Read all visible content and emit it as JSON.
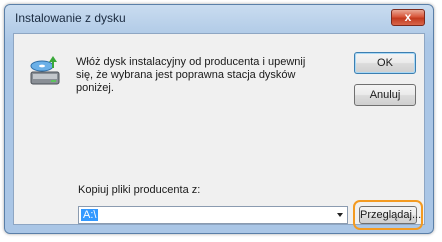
{
  "window": {
    "title": "Instalowanie z dysku",
    "close_label": "x"
  },
  "message": "Włóż dysk instalacyjny od producenta i upewnij się, że wybrana jest poprawna stacja dysków poniżej.",
  "buttons": {
    "ok": "OK",
    "cancel": "Anuluj",
    "browse": "Przeglądaj..."
  },
  "copy_from": {
    "label": "Kopiuj pliki producenta z:",
    "value": "A:\\"
  },
  "icons": {
    "disk": "install-disk-icon",
    "close": "close-icon",
    "dropdown": "chevron-down-icon"
  },
  "colors": {
    "highlight": "#f39a21",
    "close_button": "#c23b1f",
    "selection": "#3399ff"
  }
}
